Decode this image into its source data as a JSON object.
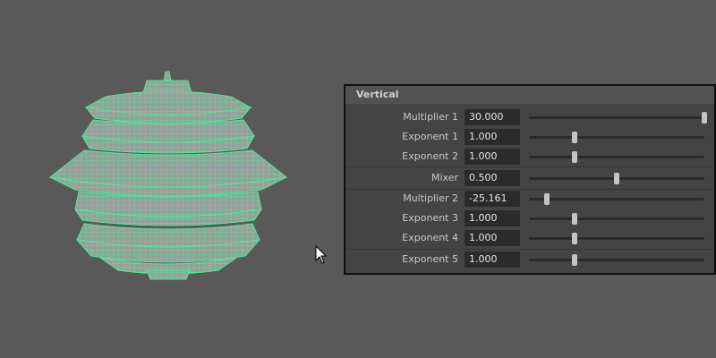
{
  "panel": {
    "header": "Vertical",
    "rows": [
      {
        "label": "Multiplier 1",
        "value": "30.000",
        "slider": 1.0
      },
      {
        "label": "Exponent 1",
        "value": "1.000",
        "slider": 0.26
      },
      {
        "label": "Exponent 2",
        "value": "1.000",
        "slider": 0.26
      },
      {
        "label": "Mixer",
        "value": "0.500",
        "slider": 0.5
      },
      {
        "label": "Multiplier 2",
        "value": "-25.161",
        "slider": 0.1
      },
      {
        "label": "Exponent 3",
        "value": "1.000",
        "slider": 0.26
      },
      {
        "label": "Exponent 4",
        "value": "1.000",
        "slider": 0.26
      },
      {
        "label": "Exponent 5",
        "value": "1.000",
        "slider": 0.26
      }
    ]
  },
  "viewport": {
    "object": "wireframe-mesh",
    "wire_color": "#4fe89a",
    "fill_color": "#9a9a9a"
  }
}
